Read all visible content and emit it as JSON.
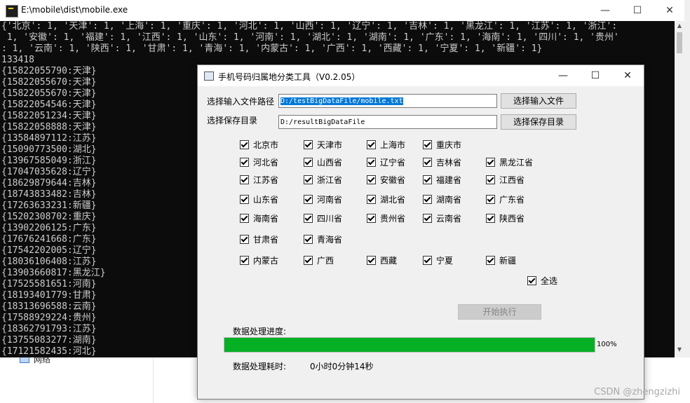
{
  "console": {
    "title": "E:\\mobile\\dist\\mobile.exe",
    "lines": [
      "{'北京': 1, '天津': 1, '上海': 1, '重庆': 1, '河北': 1, '山西': 1, '辽宁': 1, '吉林': 1, '黑龙江': 1, '江苏': 1, '浙江':",
      " 1, '安徽': 1, '福建': 1, '江西': 1, '山东': 1, '河南': 1, '湖北': 1, '湖南': 1, '广东': 1, '海南': 1, '四川': 1, '贵州'",
      ": 1, '云南': 1, '陕西': 1, '甘肃': 1, '青海': 1, '内蒙古': 1, '广西': 1, '西藏': 1, '宁夏': 1, '新疆': 1}",
      "133418",
      "{15822055790:天津}",
      "{15822055670:天津}",
      "{15822055670:天津}",
      "{15822054546:天津}",
      "{15822051234:天津}",
      "{15822058888:天津}",
      "{13584897112:江苏}",
      "{15090773500:湖北}",
      "{13967585049:浙江}",
      "{17047035628:辽宁}",
      "{18629879644:吉林}",
      "{18743833482:吉林}",
      "{17263633231:新疆}",
      "{15202308702:重庆}",
      "{13902206125:广东}",
      "{17676241668:广东}",
      "{17542202005:辽宁}",
      "{18036106408:江苏}",
      "{13903660817:黑龙江}",
      "{17525581651:河南}",
      "{18193401779:甘肃}",
      "{18313696588:云南}",
      "{17588929224:贵州}",
      "{18362791793:江苏}",
      "{13755083277:湖南}",
      "{17121582435:河北}"
    ]
  },
  "explorer": {
    "item_label": "网络"
  },
  "dialog": {
    "title": "手机号码归属地分类工具（V0.2.05）",
    "input_label": "选择输入文件路径",
    "input_value": "D:/testBigDataFile/mobile.txt",
    "input_button": "选择输入文件",
    "save_label": "选择保存目录",
    "save_value": "D:/resultBigDataFile",
    "save_button": "选择保存目录",
    "provinces": [
      [
        "北京市",
        "天津市",
        "上海市",
        "重庆市"
      ],
      [
        "河北省",
        "山西省",
        "辽宁省",
        "吉林省",
        "黑龙江省"
      ],
      [
        "江苏省",
        "浙江省",
        "安徽省",
        "福建省",
        "江西省"
      ],
      [
        "山东省",
        "河南省",
        "湖北省",
        "湖南省",
        "广东省"
      ],
      [
        "海南省",
        "四川省",
        "贵州省",
        "云南省",
        "陕西省"
      ],
      [
        "甘肃省",
        "青海省"
      ],
      [
        "内蒙古",
        "广西",
        "西藏",
        "宁夏",
        "新疆"
      ]
    ],
    "select_all": "全选",
    "start_button": "开始执行",
    "progress_label": "数据处理进度:",
    "progress_value": 1.0,
    "progress_text": "100%",
    "elapsed_label": "数据处理耗时:",
    "elapsed_value": "0小时0分钟14秒"
  },
  "watermark": "CSDN @zhengzizhi"
}
